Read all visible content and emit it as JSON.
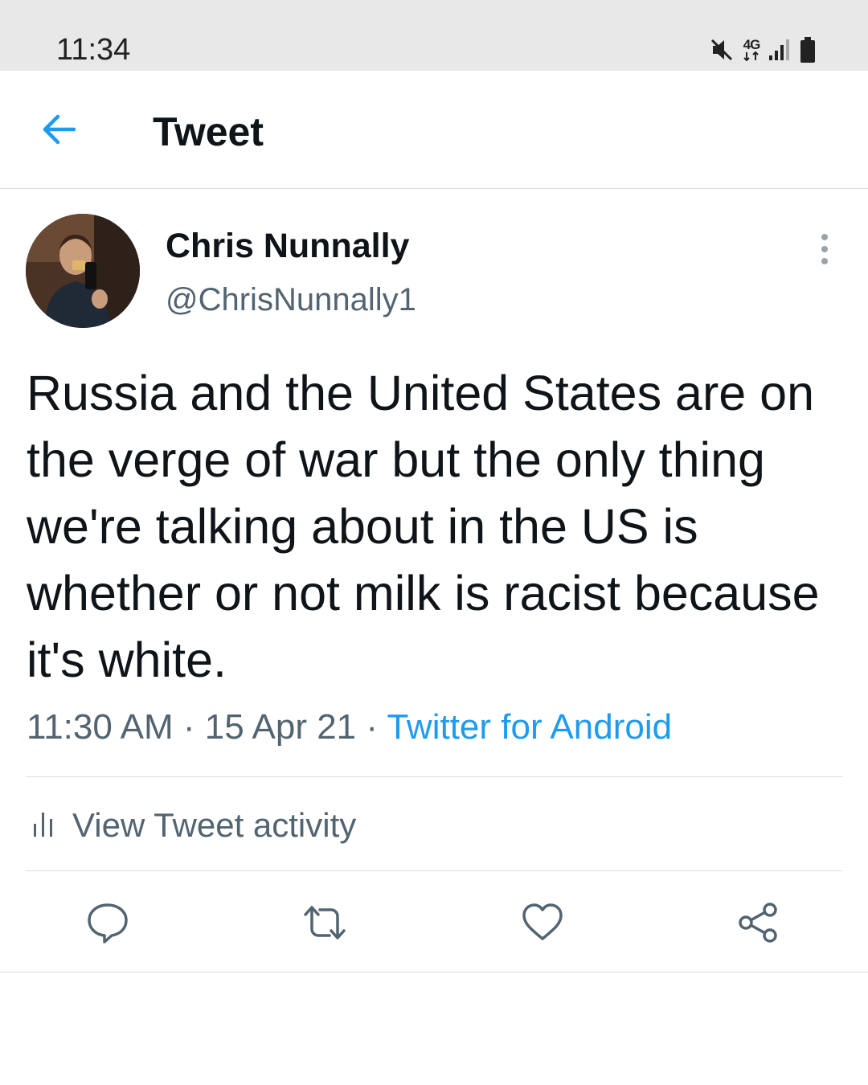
{
  "status_bar": {
    "time": "11:34",
    "network_label": "4G",
    "icons": [
      "mute-icon",
      "network-4g-icon",
      "signal-icon",
      "battery-icon"
    ]
  },
  "header": {
    "title": "Tweet",
    "back_icon": "back-arrow-icon"
  },
  "tweet": {
    "author_name": "Chris Nunnally",
    "author_handle": "@ChrisNunnally1",
    "text": "Russia and the United States are on the verge of war but the only thing we're talking about in the US is whether or not milk is racist because it's white.",
    "time": "11:30 AM",
    "separator": "·",
    "date": "15 Apr 21",
    "source": "Twitter for Android"
  },
  "activity": {
    "label": "View Tweet activity",
    "icon": "bar-chart-icon"
  },
  "actions": [
    "reply-icon",
    "retweet-icon",
    "like-icon",
    "share-icon"
  ],
  "colors": {
    "accent": "#1d9bf0",
    "text_primary": "#0f1419",
    "text_secondary": "#536471",
    "status_bar_bg": "#e8e8e8",
    "divider": "#dcdcdc"
  }
}
